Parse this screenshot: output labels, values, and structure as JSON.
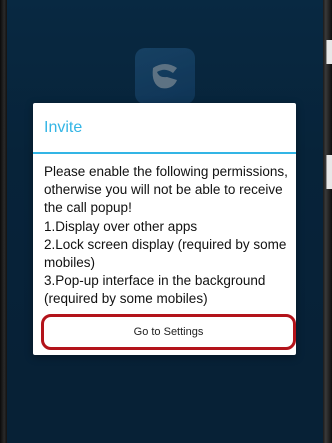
{
  "app_icon": {
    "icon": "grandstream-logo-icon"
  },
  "dialog": {
    "title": "Invite",
    "message": "Please enable the following permissions, otherwise you will not be able to receive the call popup!\n1.Display over other apps\n2.Lock screen display (required by some mobiles)\n3.Pop-up interface in the background (required by some mobiles)",
    "settings_button_label": "Go to Settings"
  },
  "colors": {
    "accent": "#33b5e5",
    "button_outline": "#b3131a",
    "background": "#0a2b45"
  }
}
